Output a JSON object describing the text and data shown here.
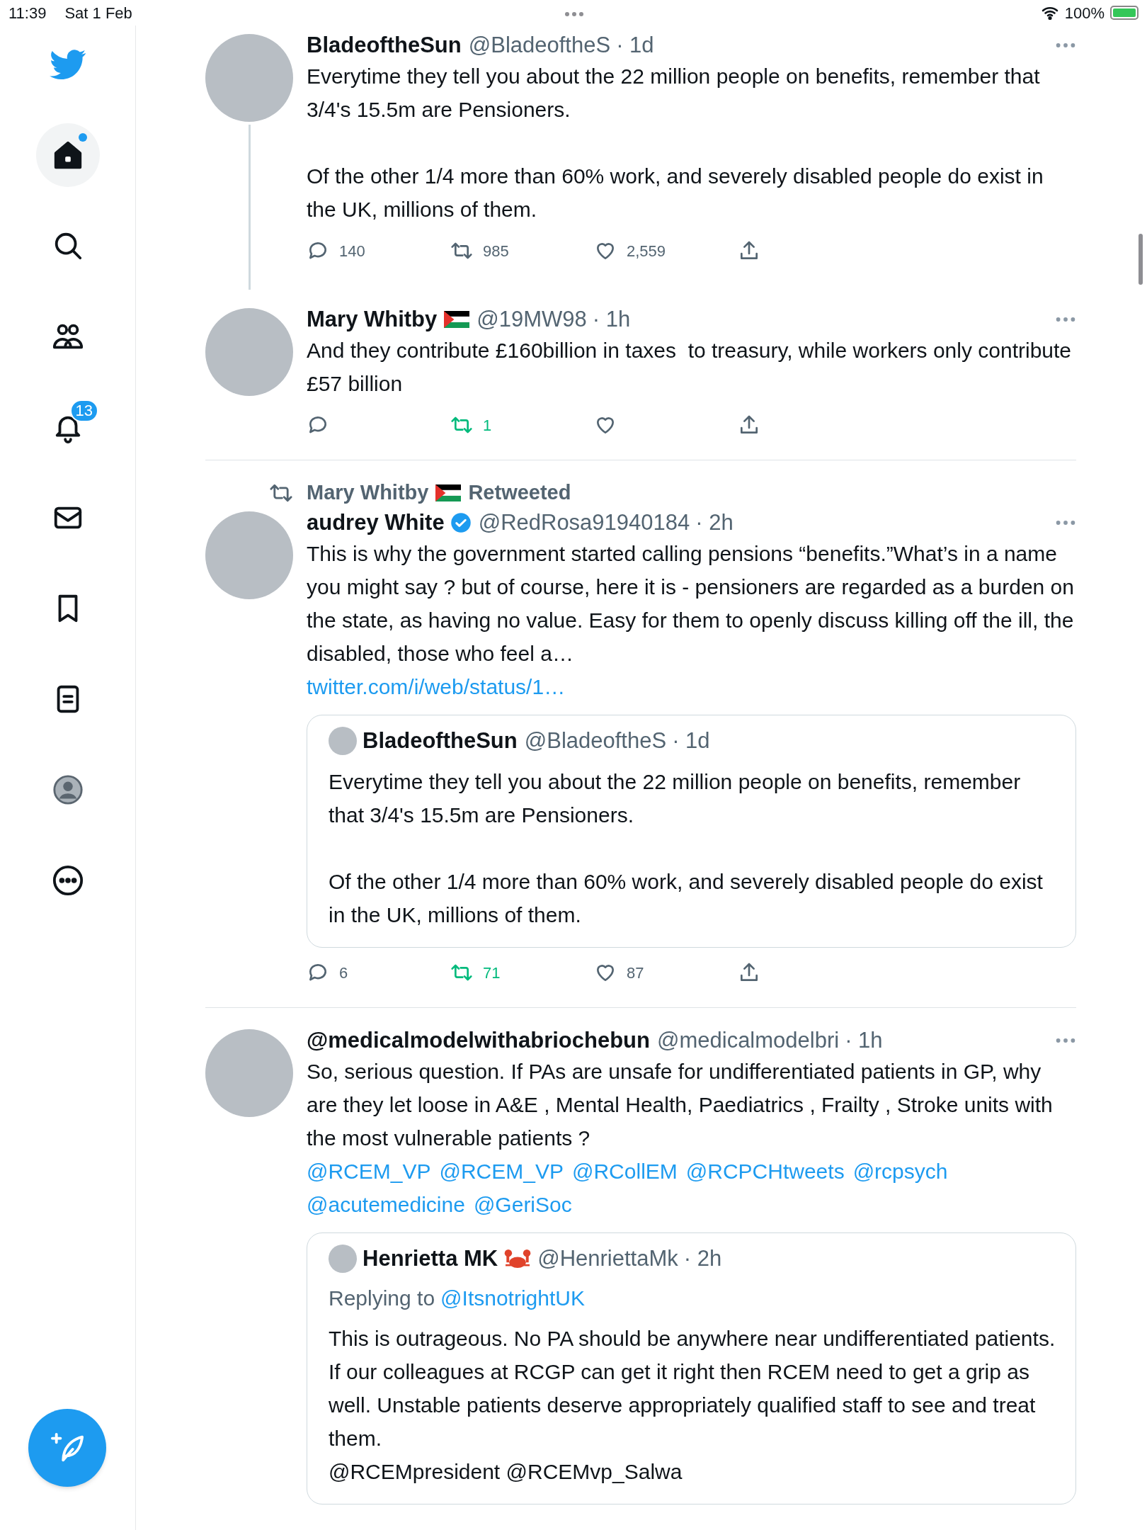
{
  "status_bar": {
    "time": "11:39",
    "date": "Sat 1 Feb",
    "battery": "100%"
  },
  "sidebar": {
    "items": [
      {
        "kind": "logo",
        "selected": false
      },
      {
        "kind": "home",
        "selected": true,
        "dot": true
      },
      {
        "kind": "search",
        "selected": false
      },
      {
        "kind": "communities",
        "selected": false
      },
      {
        "kind": "notifications",
        "selected": false,
        "badge": "13"
      },
      {
        "kind": "messages",
        "selected": false
      },
      {
        "kind": "bookmarks",
        "selected": false
      },
      {
        "kind": "lists",
        "selected": false
      },
      {
        "kind": "profile",
        "selected": false
      },
      {
        "kind": "more",
        "selected": false
      }
    ]
  },
  "tweets": [
    {
      "name": "BladeoftheSun",
      "handle": "@BladeoftheS",
      "time": "· 1d",
      "thread_continues": true,
      "divider": false,
      "body": [
        {
          "kind": "text",
          "text": "Everytime they tell you about the 22 million people on benefits, remember that 3/4's 15.5m are Pensioners.\n\nOf the other 1/4 more than 60% work, and severely disabled people do exist in the UK, millions of them."
        }
      ],
      "actions": {
        "replies": "140",
        "retweets": "985",
        "likes": "2,559",
        "retweeted": false
      }
    },
    {
      "name": "Mary Whitby",
      "flag": true,
      "handle": "@19MW98",
      "time": "· 1h",
      "thread_continues": false,
      "divider": true,
      "body": [
        {
          "kind": "text",
          "text": "And they contribute £160billion in taxes  to treasury, while workers only contribute £57 billion"
        }
      ],
      "actions": {
        "retweets": "1",
        "retweeted": true
      }
    },
    {
      "retweeted_by": {
        "name": "Mary Whitby",
        "flag": true,
        "label": "Retweeted"
      },
      "name": "audrey White",
      "verified": true,
      "handle": "@RedRosa91940184",
      "time": "· 2h",
      "thread_continues": false,
      "divider": true,
      "body": [
        {
          "kind": "text",
          "text": "This is why the government started calling pensions “benefits.”What’s in a name you might say ? but of course, here it is - pensioners are regarded as a burden on the state, as having no value. Easy for them to openly discuss killing off the ill, the disabled, those who feel a…"
        },
        {
          "kind": "link",
          "text": "twitter.com/i/web/status/1…"
        }
      ],
      "quote": {
        "name": "BladeoftheSun",
        "handle": "@BladeoftheS",
        "time": "· 1d",
        "text": "Everytime they tell you about the 22 million people on benefits, remember that 3/4's 15.5m are Pensioners.\n\nOf the other 1/4 more than 60% work, and severely disabled people do exist in the UK, millions of them."
      },
      "actions": {
        "replies": "6",
        "retweets": "71",
        "likes": "87",
        "retweeted": true
      }
    },
    {
      "name": "@medicalmodelwithabriochebun",
      "handle": "@medicalmodelbri",
      "time": "· 1h",
      "thread_continues": false,
      "divider": false,
      "body": [
        {
          "kind": "text",
          "text": "So, serious question. If PAs are unsafe for undifferentiated patients in GP, why are they let loose in A&E , Mental Health, Paediatrics , Frailty , Stroke units with the most vulnerable patients ?"
        },
        {
          "kind": "mentions",
          "items": [
            "@RCEM_VP",
            "@RCEM_VP",
            "@RCollEM",
            "@RCPCHtweets",
            "@rcpsych",
            "@acutemedicine",
            "@GeriSoc"
          ]
        }
      ],
      "quote": {
        "name": "Henrietta MK",
        "crab": true,
        "handle": "@HenriettaMk",
        "time": "· 2h",
        "replying_to": {
          "label": "Replying to",
          "handle": "@ItsnotrightUK"
        },
        "text": "This is outrageous. No PA should be anywhere near undifferentiated patients. If our colleagues at RCGP can get it right then RCEM need to get a grip as well. Unstable patients deserve appropriately qualified staff to see and treat them.\n@RCEMpresident @RCEMvp_Salwa"
      }
    }
  ]
}
